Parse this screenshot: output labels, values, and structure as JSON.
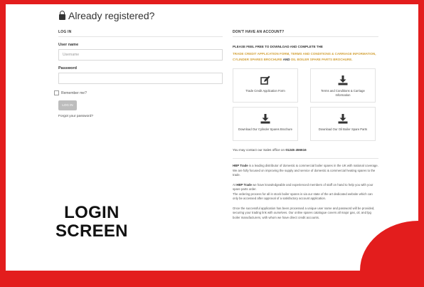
{
  "page_title": "Already registered?",
  "login": {
    "section_title": "LOG IN",
    "username_label": "User name",
    "username_value": "Username",
    "password_label": "Password",
    "password_value": "",
    "remember_label": "Remember me?",
    "login_button": "LOG IN",
    "forgot_link": "Forgot your password?"
  },
  "account": {
    "section_title": "DON'T HAVE AN ACCOUNT?",
    "intro": "PLEASE FEEL FREE TO DOWNLOAD AND COMPLETE THE",
    "links_line1": "TRADE CREDIT APPLICATION FORM, TERMS AND CONDITIONS & CARRIAGE INFORMATION,",
    "links_line2_a": "CYLINDER SPARES BROCHURE",
    "links_and": "AND",
    "links_line2_b": "OIL BOILER SPARE PARTS BROCHURE.",
    "downloads": [
      {
        "label": "Trade Credit Application Form",
        "icon": "edit-icon"
      },
      {
        "label": "Terms and Conditions & Carriage Information",
        "icon": "download-icon"
      },
      {
        "label": "Download Our Cylinder Spares Brochure",
        "icon": "download-icon"
      },
      {
        "label": "Download Our Oil Boiler Spare Parts",
        "icon": "download-icon"
      }
    ],
    "contact_prefix": "You may contact our Sales office on",
    "contact_phone": "01245 456616"
  },
  "about": {
    "p1_brand": "HBP Trade",
    "p1_text": "is a leading distributor of domestic & commercial boiler spares in the UK with national coverage.",
    "p1_text2": "We are fully focused on improving the supply and service of domestic & commercial heating spares to the trade.",
    "p2_prefix": "At",
    "p2_brand": "HBP Trade",
    "p2_text": "we have knowledgeable and experienced members of staff on hand to help you with your spare parts order.",
    "p2_text2": "The ordering process for all in stock boiler spares is via our state of the art dedicated website which can only be accessed after approval of a satisfactory account application.",
    "p3_text": "Once the successful application has been processed a unique user name and password will be provided, securing your trading link with ourselves. Our online spares catalogue covers all major gas, oil, and lpg boiler manufacturers, with whom we have direct credit accounts."
  },
  "caption": {
    "line1": "LOGIN",
    "line2": "SCREEN"
  },
  "colors": {
    "frame": "#e31d1d",
    "link": "#d3a23a",
    "button": "#bdbdbd"
  }
}
